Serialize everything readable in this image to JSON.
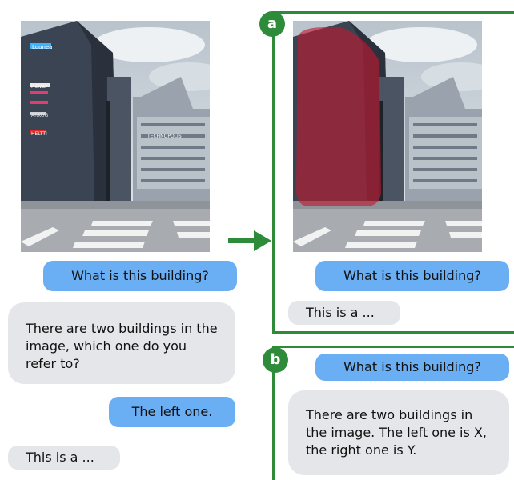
{
  "photo": {
    "building_signs": [
      "Lounea",
      "Helvar",
      "ARKOG",
      "HELTTI"
    ],
    "right_building_sign": "TECHNOPOLIS"
  },
  "left_conversation": {
    "user_message_1": "What is this building?",
    "bot_message_1": "There are two buildings in the image, which one do you refer to?",
    "user_message_2": "The left one.",
    "bot_message_2": "This is a ..."
  },
  "panel_a": {
    "label": "a",
    "user_message": "What is this building?",
    "bot_message": "This is a ...",
    "highlight_color": "#c0182f"
  },
  "panel_b": {
    "label": "b",
    "user_message": "What is this building?",
    "bot_message": "There are two buildings in the image. The left one is X, the right one is Y."
  },
  "colors": {
    "user_bubble": "#6aaef4",
    "bot_bubble": "#e5e6e9",
    "accent": "#2e8b3a"
  }
}
